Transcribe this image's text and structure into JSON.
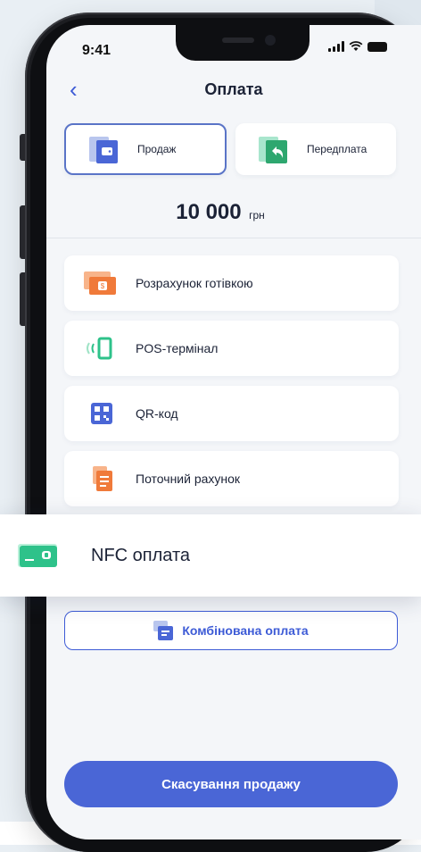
{
  "status_bar": {
    "time": "9:41"
  },
  "nav": {
    "back_icon": "chevron-left-icon",
    "back_glyph": "‹",
    "title": "Оплата"
  },
  "segments": [
    {
      "label": "Продаж",
      "icon": "wallet-icon",
      "selected": true
    },
    {
      "label": "Передплата",
      "icon": "return-arrow-icon",
      "selected": false
    }
  ],
  "amount": {
    "value": "10 000",
    "currency": "грн"
  },
  "methods": [
    {
      "label": "Розрахунок готівкою",
      "icon": "cash-icon"
    },
    {
      "label": "POS-термінал",
      "icon": "pos-terminal-icon"
    },
    {
      "label": "QR-код",
      "icon": "qr-code-icon"
    },
    {
      "label": "Поточний рахунок",
      "icon": "document-icon"
    }
  ],
  "nfc": {
    "label": "NFC оплата",
    "icon": "nfc-card-icon"
  },
  "combined": {
    "label": "Комбінована оплата",
    "icon": "combined-payment-icon"
  },
  "cancel": {
    "label": "Скасування продажу"
  },
  "colors": {
    "accent": "#4a66d6",
    "selected_border": "#5a74c7",
    "cash": "#f07a3a",
    "green": "#2ec28a",
    "qr": "#4a66d6",
    "document": "#f07a3a"
  }
}
